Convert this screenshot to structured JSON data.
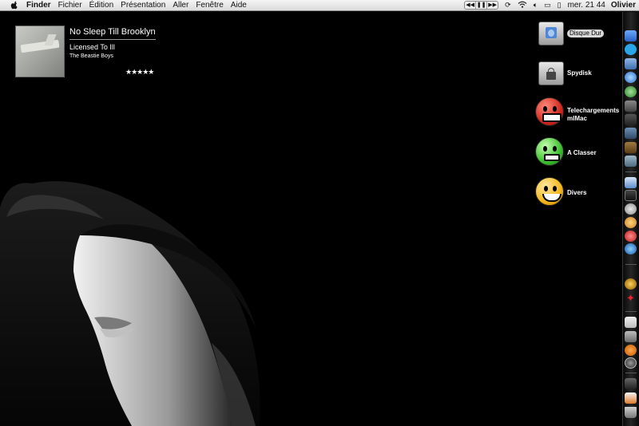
{
  "menubar": {
    "app_name": "Finder",
    "items": [
      "Fichier",
      "Édition",
      "Présentation",
      "Aller",
      "Fenêtre",
      "Aide"
    ],
    "clock": "mer. 21 44",
    "user": "Olivier"
  },
  "now_playing": {
    "title": "No Sleep Till Brooklyn",
    "album": "Licensed To Ill",
    "artist": "The Beastie Boys",
    "rating_stars": "★★★★★",
    "rating_value": 5
  },
  "desktop_icons": [
    {
      "label": "Disque Dur",
      "icon": "hard-disk-icon"
    },
    {
      "label": "Spydisk",
      "icon": "locked-disk-icon"
    },
    {
      "label": "Telechargements mlMac",
      "icon": "angry-smiley-icon"
    },
    {
      "label": "A Classer",
      "icon": "sick-smiley-icon"
    },
    {
      "label": "Divers",
      "icon": "happy-smiley-icon"
    }
  ],
  "colors": {
    "desktop_background": "#000000",
    "menubar": "#e6e6e6",
    "smiley_red": "#d2281e",
    "smiley_green": "#3cbf2e",
    "smiley_yellow": "#f2b61a"
  }
}
